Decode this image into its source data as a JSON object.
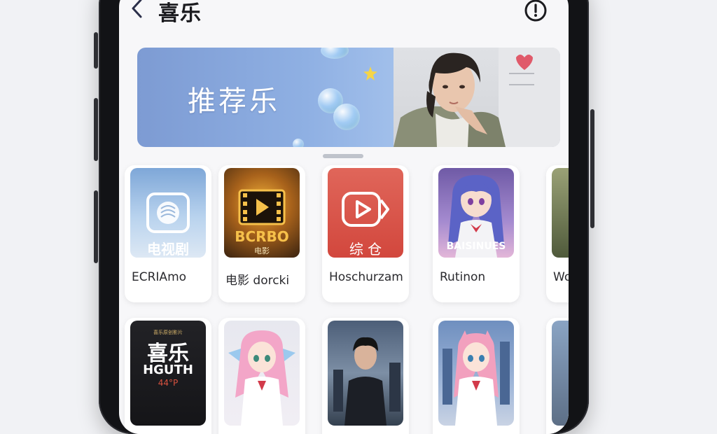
{
  "header": {
    "title": "喜乐",
    "back_icon": "chevron-left-icon",
    "info_icon": "alert-circle-icon"
  },
  "banner": {
    "text": "推荐乐"
  },
  "row1": [
    {
      "art_text": "电视剧",
      "caption": "ECRIAmo"
    },
    {
      "art_text": "BCRBO",
      "art_sub": "电影",
      "caption": "电影 dorcki"
    },
    {
      "art_text": "综 仓",
      "caption": "Hoschurzam"
    },
    {
      "art_text": "BAISINUES",
      "caption": "Rutinon"
    },
    {
      "caption": "Wo"
    }
  ],
  "row2": [
    {
      "art_small": "喜乐原创影片",
      "art_text": "喜乐",
      "art_sub": "HGUTH",
      "art_sub2": "44°P"
    },
    {},
    {},
    {},
    {}
  ],
  "colors": {
    "accent": "#2b2f4a",
    "screen_bg": "#f7f7f9",
    "banner_blue": "#8fb0e3",
    "card_red": "#d9574c"
  }
}
